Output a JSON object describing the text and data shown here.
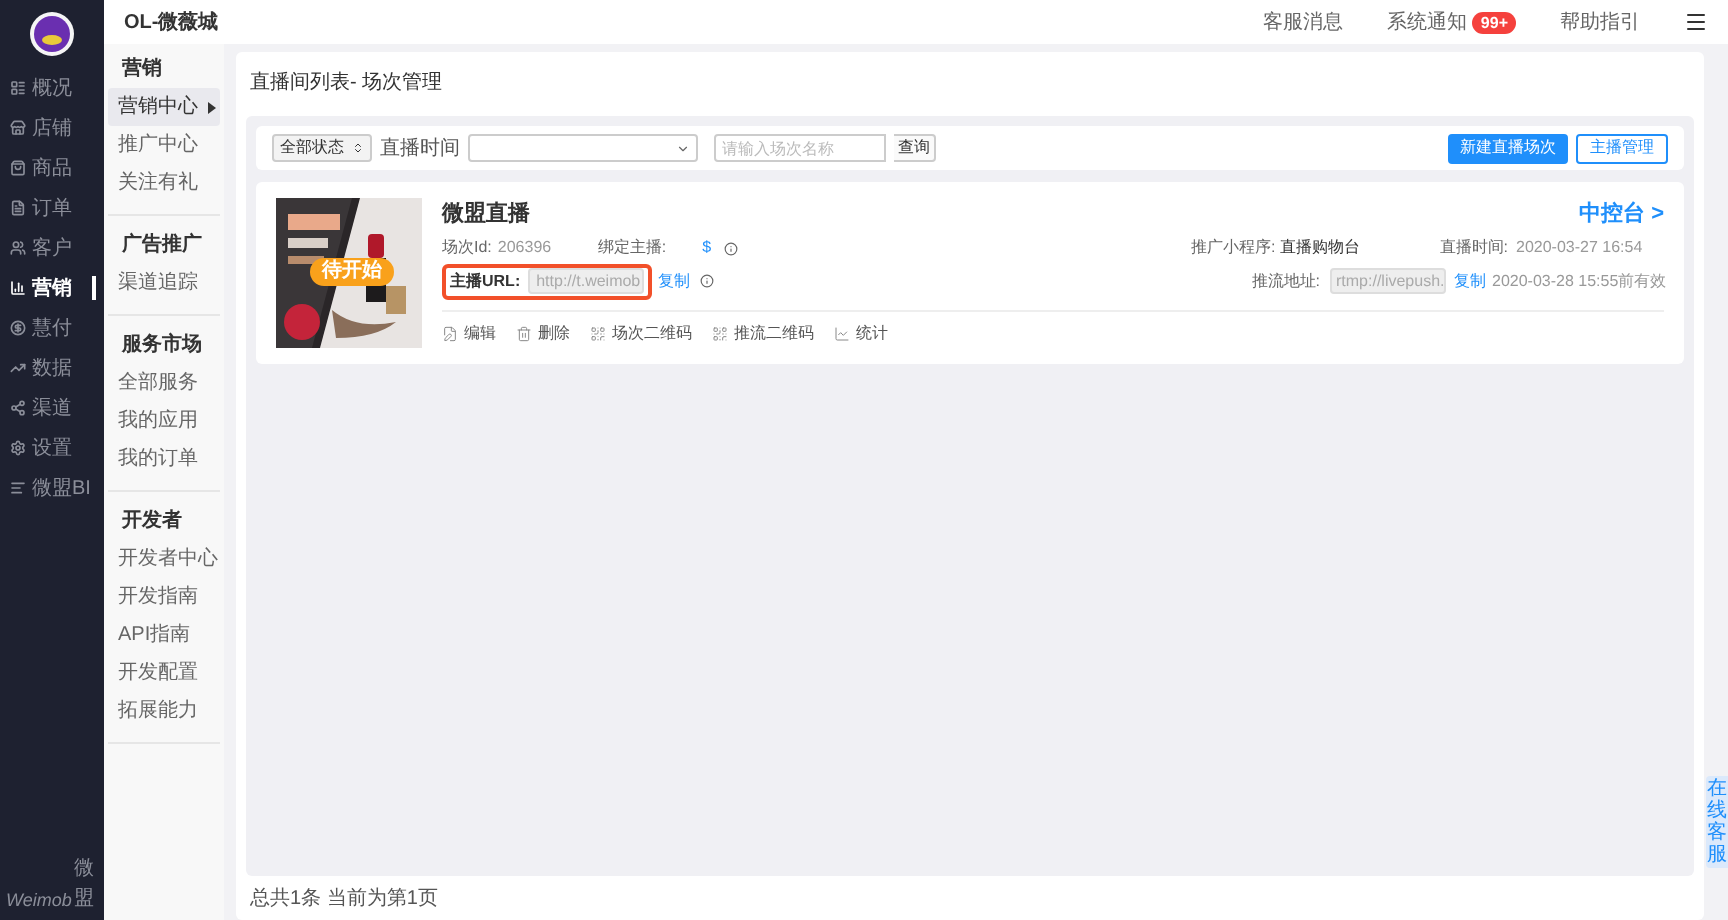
{
  "app": {
    "title": "OL-微薇城"
  },
  "header": {
    "links": [
      {
        "label": "客服消息"
      },
      {
        "label": "系统通知",
        "badge": "99+"
      },
      {
        "label": "帮助指引"
      }
    ]
  },
  "nav": {
    "items": [
      {
        "label": "概况",
        "selected": false
      },
      {
        "label": "店铺",
        "selected": false
      },
      {
        "label": "商品",
        "selected": false
      },
      {
        "label": "订单",
        "selected": false
      },
      {
        "label": "客户",
        "selected": false
      },
      {
        "label": "营销",
        "selected": true
      },
      {
        "label": "慧付",
        "selected": false
      },
      {
        "label": "数据",
        "selected": false
      },
      {
        "label": "渠道",
        "selected": false
      },
      {
        "label": "设置",
        "selected": false
      },
      {
        "label": "微盟BI",
        "selected": false
      }
    ]
  },
  "footer_logo": {
    "brand": "Weimob",
    "suffix": "微盟"
  },
  "subnav": {
    "groups": [
      {
        "title": "营销",
        "items": [
          {
            "label": "营销中心",
            "selected": true
          },
          {
            "label": "推广中心",
            "selected": false
          },
          {
            "label": "关注有礼",
            "selected": false
          }
        ]
      },
      {
        "title": "广告推广",
        "items": [
          {
            "label": "渠道追踪",
            "selected": false
          }
        ]
      },
      {
        "title": "服务市场",
        "items": [
          {
            "label": "全部服务",
            "selected": false
          },
          {
            "label": "我的应用",
            "selected": false
          },
          {
            "label": "我的订单",
            "selected": false
          }
        ]
      },
      {
        "title": "开发者",
        "items": [
          {
            "label": "开发者中心",
            "selected": false
          },
          {
            "label": "开发指南",
            "selected": false
          },
          {
            "label": "API指南",
            "selected": false
          },
          {
            "label": "开发配置",
            "selected": false
          },
          {
            "label": "拓展能力",
            "selected": false
          }
        ]
      }
    ]
  },
  "breadcrumb": "直播间列表- 场次管理",
  "filters": {
    "status": "全部状态",
    "time_label": "直播时间",
    "name_placeholder": "请输入场次名称",
    "search_button": "查询",
    "create_button": "新建直播场次",
    "anchor_button": "主播管理"
  },
  "sessions": [
    {
      "status": "待开始",
      "title": "微盟直播",
      "console_link": "中控台 >",
      "id_label": "场次Id:",
      "id": "206396",
      "anchor_label": "绑定主播:",
      "anchor": "$",
      "program_label": "推广小程序:",
      "program": "直播购物台",
      "time_label": "直播时间:",
      "time": "2020-03-27 16:54",
      "url_label": "主播URL:",
      "url": "http://t.weimob",
      "url_copy": "复制",
      "url_highlighted": true,
      "push_label": "推流地址:",
      "push": "rtmp://livepush.",
      "push_copy": "复制",
      "push_expiry": "2020-03-28 15:55前有效",
      "actions": [
        {
          "label": "编辑"
        },
        {
          "label": "删除"
        },
        {
          "label": "场次二维码"
        },
        {
          "label": "推流二维码"
        },
        {
          "label": "统计"
        }
      ]
    }
  ],
  "pagination": "总共1条 当前为第1页",
  "online_service": "在线客服"
}
